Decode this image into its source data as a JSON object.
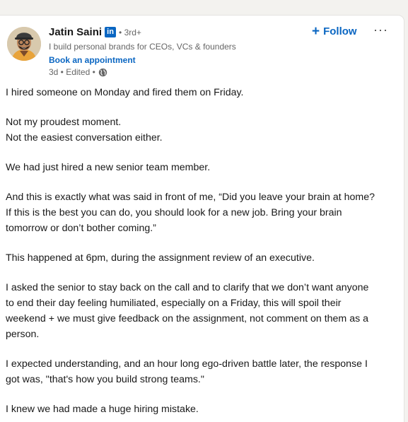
{
  "post": {
    "author": {
      "name": "Jatin Saini",
      "linkedin_badge": "in",
      "degree": "• 3rd+",
      "headline": "I build personal brands for CEOs, VCs & founders",
      "link_label": "Book an appointment",
      "meta": "3d • Edited •",
      "meta_icon": "globe-icon"
    },
    "follow_label": "Follow",
    "follow_icon": "plus-icon",
    "more_icon": "more-icon",
    "more_label": "···",
    "accent_color": "#0a66c2",
    "paragraphs": [
      [
        "I hired someone on Monday and fired them on Friday."
      ],
      [
        "Not my proudest moment.",
        "Not the easiest conversation either."
      ],
      [
        "We had just hired a new senior team member."
      ],
      [
        "And this is exactly what was said in front of me, “Did you leave your brain at home?",
        "If this is the best you can do, you should look for a new job. Bring your brain",
        "tomorrow or don’t bother coming.”"
      ],
      [
        "This happened at 6pm, during the assignment review of an executive."
      ],
      [
        "I asked the senior to stay back on the call and to clarify that we don’t want anyone",
        "to end their day feeling humiliated, especially on a Friday, this will spoil their",
        "weekend + we must give feedback on the assignment, not comment on them as a",
        "person."
      ],
      [
        "I expected understanding, and an hour long ego-driven battle later, the response I",
        "got was, \"that's how you build strong teams.\""
      ],
      [
        "I knew we had made a huge hiring mistake."
      ]
    ]
  }
}
